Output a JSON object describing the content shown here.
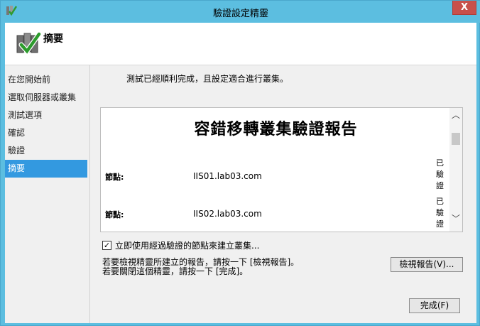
{
  "window": {
    "title": "驗證設定精靈",
    "close_label": "X"
  },
  "header": {
    "title": "摘要"
  },
  "sidebar": {
    "items": [
      {
        "label": "在您開始前",
        "active": false
      },
      {
        "label": "選取伺服器或叢集",
        "active": false
      },
      {
        "label": "測試選項",
        "active": false
      },
      {
        "label": "確認",
        "active": false
      },
      {
        "label": "驗證",
        "active": false
      },
      {
        "label": "摘要",
        "active": true
      }
    ]
  },
  "main": {
    "result_message": "測試已經順利完成，且設定適合進行叢集。",
    "report": {
      "title": "容錯移轉叢集驗證報告",
      "rows": [
        {
          "label": "節點:",
          "value": "IIS01.lab03.com",
          "status": "已驗證"
        },
        {
          "label": "節點:",
          "value": "IIS02.lab03.com",
          "status": "已驗證"
        }
      ]
    },
    "create_cluster_checkbox": {
      "label": "立即使用經過驗證的節點來建立叢集...",
      "checked": true
    },
    "note_line1": "若要檢視精靈所建立的報告，請按一下 [檢視報告]。",
    "note_line2": "若要關閉這個精靈，請按一下 [完成]。",
    "view_report_button": "檢視報告(V)...",
    "finish_button": "完成(F)"
  }
}
